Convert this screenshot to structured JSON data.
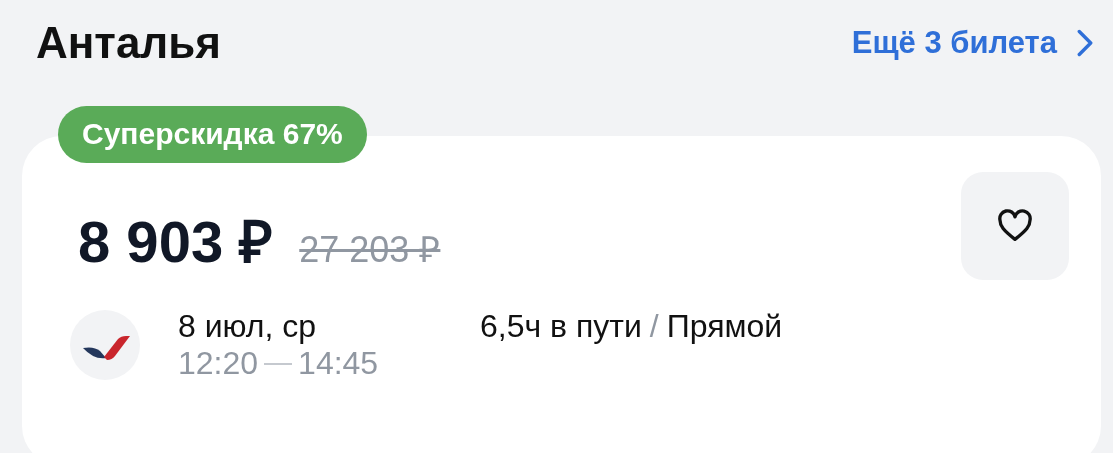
{
  "header": {
    "title": "Анталья",
    "more_link": "Ещё 3 билета"
  },
  "ticket": {
    "badge": "Суперскидка 67%",
    "price": "8 903 ₽",
    "old_price": "27 203 ₽",
    "favorite": false,
    "date": "8 июл, ср",
    "depart": "12:20",
    "arrive": "14:45",
    "duration": "6,5ч в пути",
    "separator": "/",
    "stops": "Прямой"
  }
}
